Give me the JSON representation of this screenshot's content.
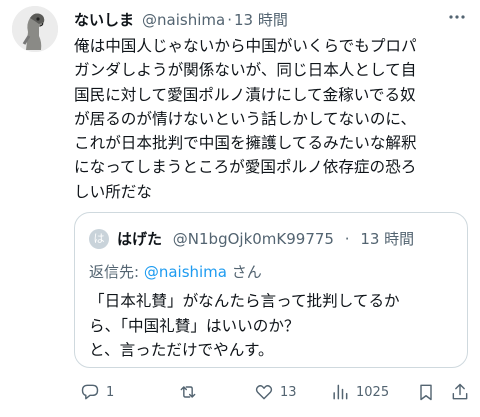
{
  "tweet": {
    "display_name": "ないしま",
    "handle": "@naishima",
    "separator": "·",
    "time": "13 時間",
    "text": "俺は中国人じゃないから中国がいくらでもプロパ\nガンダしようが関係ないが、同じ日本人として自\n国民に対して愛国ポルノ漬けにして金稼いでる奴\nが居るのが情けないという話しかしてないのに、\nこれが日本批判で中国を擁護してるみたいな解釈\nになってしまうところが愛国ポルノ依存症の恐ろ\nしい所だな"
  },
  "quote": {
    "avatar_letter": "は",
    "display_name": "はげた",
    "handle": "@N1bgOjk0mK99775",
    "separator": "·",
    "time": "13 時間",
    "reply_prefix": "返信先: ",
    "reply_mention": "@naishima",
    "reply_suffix": " さん",
    "text": "「日本礼賛」がなんたら言って批判してるか\nら、「中国礼賛」はいいのか？\nと、言っただけでやんす。"
  },
  "actions": {
    "replies": "1",
    "retweets": "",
    "likes": "13",
    "views": "1025"
  },
  "icons": [
    "more-icon",
    "reply-icon",
    "retweet-icon",
    "like-icon",
    "views-icon",
    "bookmark-icon",
    "share-icon"
  ]
}
